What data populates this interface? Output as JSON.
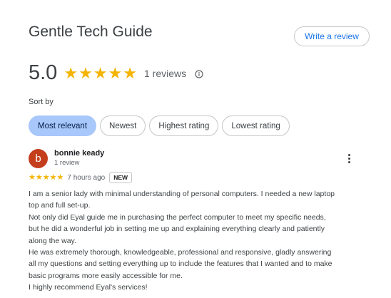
{
  "header": {
    "title": "Gentle Tech Guide",
    "write_review_label": "Write a review"
  },
  "summary": {
    "rating": "5.0",
    "stars": 5,
    "review_count_label": "1 reviews",
    "info_icon": "info-icon"
  },
  "sort": {
    "label": "Sort by",
    "options": [
      "Most relevant",
      "Newest",
      "Highest rating",
      "Lowest rating"
    ],
    "selected": "Most relevant"
  },
  "review": {
    "avatar_letter": "b",
    "avatar_color": "#c43e1c",
    "reviewer_name": "bonnie keady",
    "reviewer_meta": "1 review",
    "stars": 5,
    "time_ago": "7 hours ago",
    "badge": "NEW",
    "text_lines": [
      "I am a senior lady with minimal understanding of personal computers. I needed a new laptop",
      "top and full set-up.",
      "Not only did Eyal guide me in purchasing the perfect computer to meet my specific needs,",
      "but he did a wonderful job in setting me up and explaining everything clearly and patiently",
      "along the way.",
      "He was extremely thorough, knowledgeable, professional and responsive, gladly answering",
      "all my questions and setting everything up to include the features that I wanted and to make",
      "basic programs more easily accessible for me.",
      "I highly recommend Eyal's services!"
    ]
  },
  "colors": {
    "star": "#f4b400",
    "accent": "#1a73e8",
    "active_chip": "#a8c7fa"
  }
}
